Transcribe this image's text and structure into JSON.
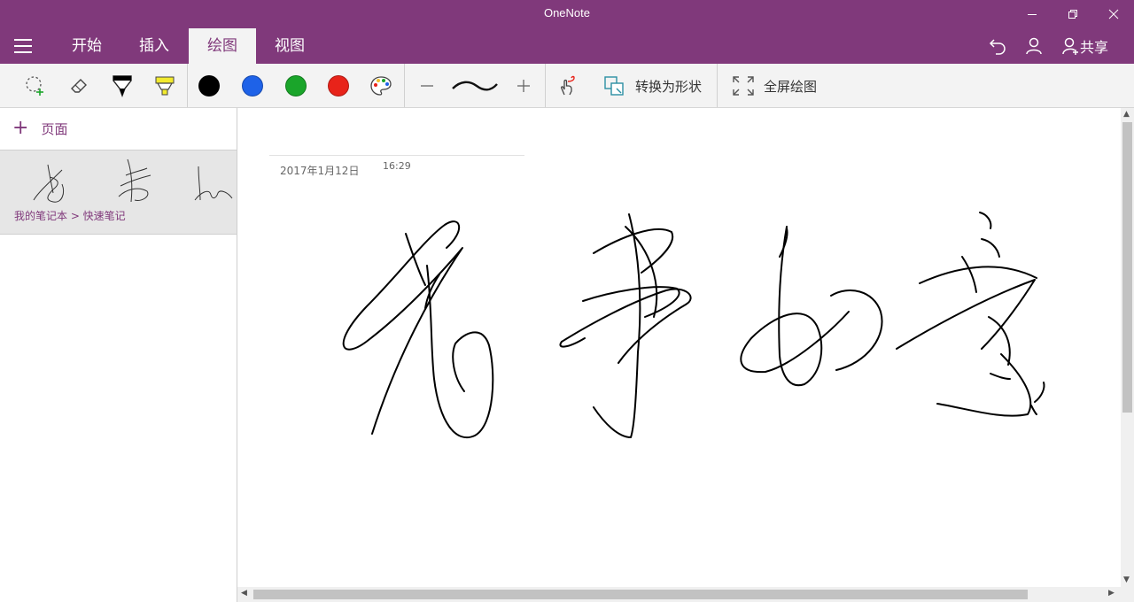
{
  "app": {
    "title": "OneNote"
  },
  "window_controls": [
    "minimize",
    "restore",
    "close"
  ],
  "tabs": [
    {
      "label": "开始",
      "active": false
    },
    {
      "label": "插入",
      "active": false
    },
    {
      "label": "绘图",
      "active": true
    },
    {
      "label": "视图",
      "active": false
    }
  ],
  "header_right": {
    "share_label": "共享"
  },
  "toolbar": {
    "tools": [
      "lasso-select-icon",
      "eraser-icon",
      "pen-icon",
      "highlighter-icon"
    ],
    "colors": [
      "#000000",
      "#1e62e8",
      "#1aa52a",
      "#e8231a"
    ],
    "convert_label": "转换为形状",
    "fullscreen_label": "全屏绘图"
  },
  "sidebar": {
    "add_page_label": "页面",
    "page_item": {
      "breadcrumb": "我的笔记本 > 快速笔记"
    }
  },
  "note": {
    "date": "2017年1月12日",
    "time": "16:29"
  },
  "colors": {
    "accent": "#80397b",
    "toolbar_bg": "#f3f3f3",
    "selected_page_bg": "#e6e6e6"
  }
}
